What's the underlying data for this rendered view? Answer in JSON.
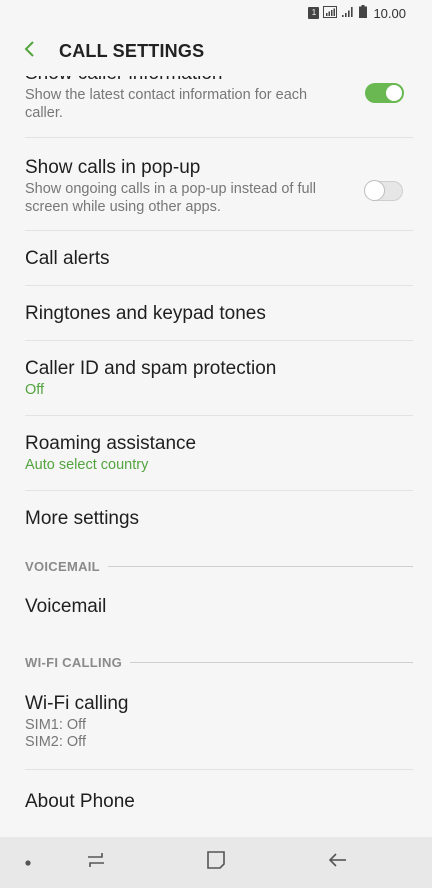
{
  "status": {
    "sim_label": "1",
    "time": "10.00"
  },
  "header": {
    "title": "CALL SETTINGS"
  },
  "settings": {
    "caller_info": {
      "title": "Show caller information",
      "desc": "Show the latest contact information for each caller.",
      "enabled": true
    },
    "popup": {
      "title": "Show calls in pop-up",
      "desc": "Show ongoing calls in a pop-up instead of full screen while using other apps.",
      "enabled": false
    },
    "call_alerts": {
      "title": "Call alerts"
    },
    "ringtones": {
      "title": "Ringtones and keypad tones"
    },
    "caller_id": {
      "title": "Caller ID and spam protection",
      "value": "Off"
    },
    "roaming": {
      "title": "Roaming assistance",
      "value": "Auto select country"
    },
    "more": {
      "title": "More settings"
    }
  },
  "voicemail_section": {
    "header": "VOICEMAIL",
    "item": {
      "title": "Voicemail"
    }
  },
  "wifi_section": {
    "header": "WI-FI CALLING",
    "item": {
      "title": "Wi-Fi calling",
      "sim1": "SIM1: Off",
      "sim2": "SIM2: Off"
    }
  },
  "about": {
    "title": "About Phone"
  },
  "colors": {
    "accent": "#53a43f",
    "toggle_on": "#6ab851",
    "background": "#f6f6f6",
    "nav_bar": "#e8e8e8"
  },
  "icons": {
    "back": "chevron-left-icon",
    "nav_dot": "dot-icon",
    "recents": "recents-icon",
    "home": "home-icon",
    "back_nav": "back-arrow-icon"
  }
}
